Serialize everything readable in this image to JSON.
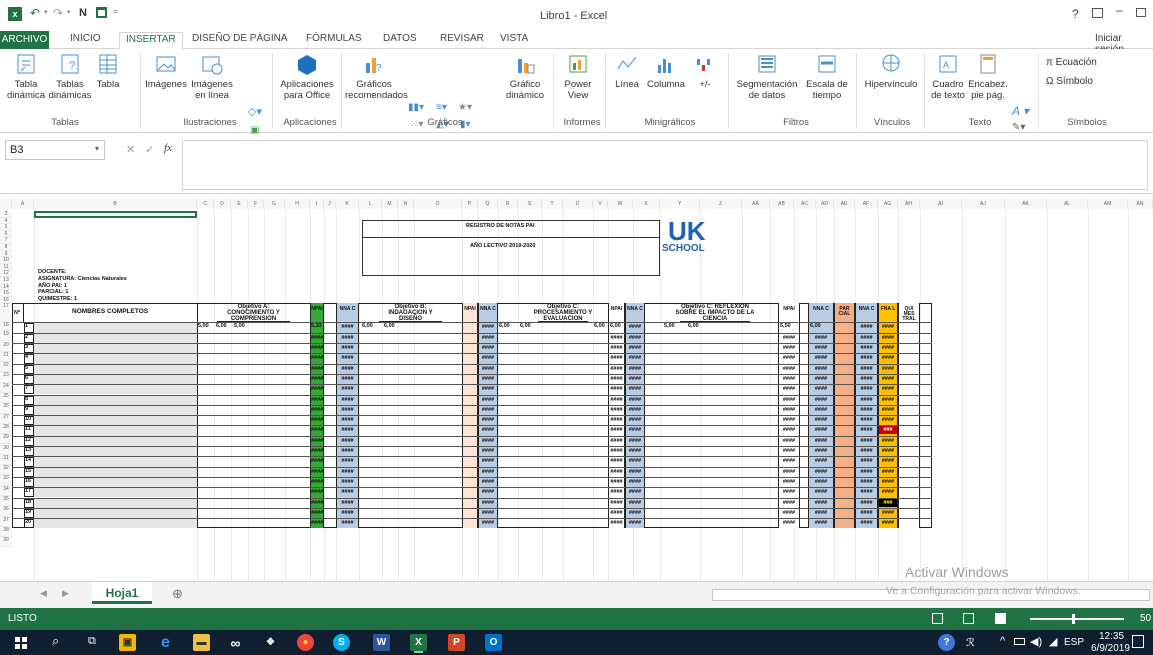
{
  "window": {
    "title": "Libro1 - Excel",
    "help": "?",
    "signin": "Iniciar sesión"
  },
  "qat": {
    "bold_n": "N"
  },
  "tabs": [
    "ARCHIVO",
    "INICIO",
    "INSERTAR",
    "DISEÑO DE PÁGINA",
    "FÓRMULAS",
    "DATOS",
    "REVISAR",
    "VISTA"
  ],
  "ribbon": {
    "tabla_dinamica": [
      "Tabla",
      "dinámica"
    ],
    "tablas_dinamicas": [
      "Tablas",
      "dinámicas"
    ],
    "tabla": "Tabla",
    "imagenes": "Imágenes",
    "imagenes_linea": [
      "Imágenes",
      "en línea"
    ],
    "aplicaciones": [
      "Aplicaciones",
      "para Office"
    ],
    "graficos_rec": [
      "Gráficos",
      "recomendados"
    ],
    "grafico_dinamico": [
      "Gráfico",
      "dinámico"
    ],
    "power_view": [
      "Power",
      "View"
    ],
    "linea": "Línea",
    "columna": "Columna",
    "ganancia": "+/-",
    "segmentacion": [
      "Segmentación",
      "de datos"
    ],
    "escala_tiempo": [
      "Escala de",
      "tiempo"
    ],
    "hipervinculo": "Hipervínculo",
    "cuadro_texto": [
      "Cuadro",
      "de texto"
    ],
    "encabezado": [
      "Encabez.",
      "pie pág."
    ],
    "ecuacion": "π Ecuación",
    "simbolo": "Ω Símbolo",
    "groups": [
      "Tablas",
      "Ilustraciones",
      "Aplicaciones",
      "Gráficos",
      "Informes",
      "Minigráficos",
      "Filtros",
      "Vínculos",
      "Texto",
      "Símbolos"
    ]
  },
  "formula_bar": {
    "name_box": "B3",
    "fx": "fx",
    "value": ""
  },
  "columns": [
    "A",
    "B",
    "C",
    "D",
    "E",
    "F",
    "G",
    "H",
    "I",
    "J",
    "K",
    "L",
    "M",
    "N",
    "O",
    "P",
    "Q",
    "R",
    "S",
    "T",
    "U",
    "V",
    "W",
    "X",
    "Y",
    "Z",
    "AA",
    "AB",
    "AC",
    "AD",
    "AE",
    "AF",
    "AG",
    "AH",
    "AI",
    "AJ",
    "AK",
    "AL",
    "AM",
    "AN"
  ],
  "sheet": {
    "header_title": "REGISTRO DE NOTAS PAI",
    "header_year": "AÑO LECTIVO 2019-2020",
    "logo_top": "UK",
    "logo_bottom": "SCHOOL",
    "info": [
      "DOCENTE:",
      "ASIGNATURA: Ciencias Naturales",
      "AÑO PAI: 1",
      "PARCIAL: 1",
      "QUIMESTRE: 1"
    ],
    "col_n": "Nº",
    "col_names": "NOMBRES COMPLETOS",
    "obj_a": [
      "Objetivo A:",
      "CONOCIMIENTO Y",
      "COMPRENSION"
    ],
    "obj_b": [
      "Objetivo B:",
      "INDAGACION Y",
      "DISEÑO"
    ],
    "obj_c": [
      "Objetivo C:",
      "PROCESAMIENTO Y",
      "EVALUACION"
    ],
    "obj_d": [
      "Objetivo C: REFLEXION",
      "SOBRE EL IMPACTO DE LA",
      "CIENCIA"
    ],
    "npai": "NPAI",
    "nnac": "NNA C",
    "parcial": "PAR CIAL",
    "fnal": "FNA L",
    "quimestral": "QUI MES TRAL",
    "row1_values": [
      "5,00",
      "6,00",
      "5,00",
      "5,33",
      "6,00",
      "6,00",
      "6,00",
      "6,00",
      "6,00",
      "6,00",
      "5,00",
      "6,00",
      "5,50",
      "6,00"
    ],
    "hash": "####",
    "hash3": "###",
    "student_numbers": [
      "1",
      "2",
      "3",
      "4",
      "5",
      "6",
      "7",
      "8",
      "9",
      "10",
      "11",
      "12",
      "13",
      "14",
      "15",
      "16",
      "17",
      "18",
      "19",
      "20"
    ],
    "row_numbers": [
      "3",
      "4",
      "5",
      "6",
      "7",
      "8",
      "9",
      "10",
      "11",
      "12",
      "13",
      "14",
      "15",
      "16",
      "17",
      "18",
      "19",
      "20",
      "21",
      "22",
      "23",
      "24",
      "25",
      "26",
      "27",
      "28",
      "29",
      "30",
      "31",
      "32",
      "33",
      "34",
      "35",
      "36",
      "37",
      "38",
      "39"
    ]
  },
  "sheet_tabs": {
    "active": "Hoja1",
    "add": "⊕"
  },
  "watermark": [
    "Activar Windows",
    "Ve a Configuración para activar Windows."
  ],
  "status": {
    "ready": "LISTO",
    "zoom": "50"
  },
  "taskbar": {
    "time": "12:35",
    "date": "6/9/2019",
    "lang": "ESP"
  },
  "colors": {
    "excel_green": "#217346",
    "npai_green": "#33aa33",
    "nnac_blue": "#b8cce4",
    "parcial_orange": "#f4b084",
    "fnal_yellow": "#ffc000",
    "tan": "#fce4d6"
  }
}
